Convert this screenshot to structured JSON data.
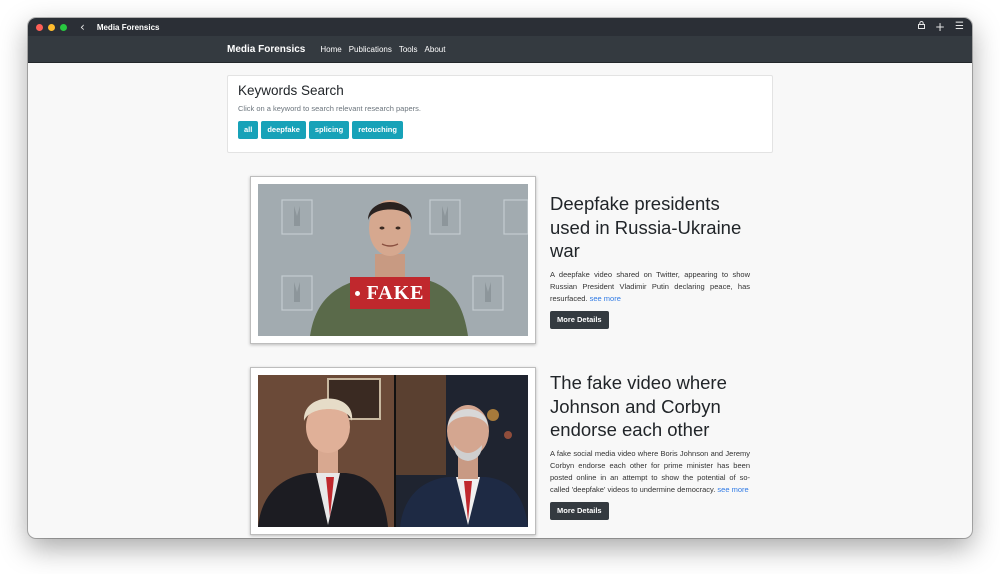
{
  "window": {
    "title": "Media Forensics"
  },
  "navbar": {
    "brand": "Media Forensics",
    "links": [
      "Home",
      "Publications",
      "Tools",
      "About"
    ]
  },
  "search": {
    "title": "Keywords Search",
    "subtitle": "Click on a keyword to search relevant research papers.",
    "tags": [
      "all",
      "deepfake",
      "splicing",
      "retouching"
    ]
  },
  "articles": [
    {
      "title": "Deepfake presidents used in Russia-Ukraine war",
      "desc": "A deepfake video shared on Twitter, appearing to show Russian President Vladimir Putin declaring peace, has resurfaced.",
      "see_more": "see more",
      "button": "More Details",
      "overlay": "FAKE"
    },
    {
      "title": "The fake video where Johnson and Corbyn endorse each other",
      "desc": "A fake social media video where Boris Johnson and Jeremy Corbyn endorse each other for prime minister has been posted online in an attempt to show the potential of so-called 'deepfake' videos to undermine democracy.",
      "see_more": "see more",
      "button": "More Details"
    }
  ],
  "colors": {
    "accent": "#17a2b8",
    "navbar": "#343a40",
    "link": "#2f7ae5",
    "fake_badge": "#c0282d"
  }
}
